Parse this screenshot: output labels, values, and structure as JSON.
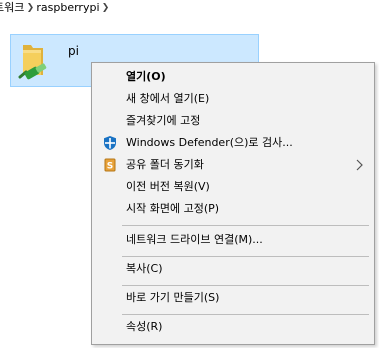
{
  "breadcrumb": {
    "items": [
      "트워크",
      "raspberrypi"
    ]
  },
  "folder": {
    "name": "pi"
  },
  "context_menu": {
    "items": [
      {
        "label": "열기(O)",
        "bold": true
      },
      {
        "label": "새 창에서 열기(E)"
      },
      {
        "label": "즐겨찾기에 고정"
      },
      {
        "label": "Windows Defender(으)로 검사...",
        "icon": "windows-defender-icon"
      },
      {
        "label": "공유 폴더 동기화",
        "icon": "sync-folder-icon",
        "submenu": true
      },
      {
        "label": "이전 버전 복원(V)"
      },
      {
        "label": "시작 화면에 고정(P)"
      },
      {
        "label": "네트워크 드라이브 연결(M)..."
      },
      {
        "label": "복사(C)"
      },
      {
        "label": "바로 가기 만들기(S)"
      },
      {
        "label": "속성(R)"
      }
    ]
  },
  "colors": {
    "selection_bg": "#cce8ff",
    "selection_border": "#99d1ff",
    "menu_bg": "#f2f2f2",
    "defender_blue": "#1a73c4",
    "sync_orange": "#e8a23a"
  }
}
